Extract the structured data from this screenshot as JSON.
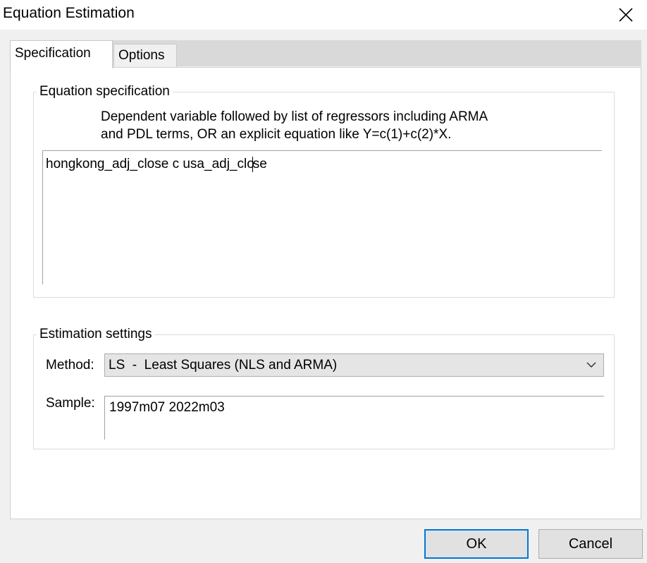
{
  "window": {
    "title": "Equation Estimation",
    "close_icon": "close-icon"
  },
  "tabs": [
    {
      "label": "Specification",
      "active": true
    },
    {
      "label": "Options",
      "active": false
    }
  ],
  "equation_spec": {
    "group_label": "Equation specification",
    "hint_line1": "Dependent variable followed by list of regressors including ARMA",
    "hint_line2": "and PDL terms, OR an explicit equation like Y=c(1)+c(2)*X.",
    "value_before_caret": "hongkong_adj_close c usa_adj_clo",
    "value_after_caret": "se"
  },
  "estimation_settings": {
    "group_label": "Estimation settings",
    "method_label": "Method:",
    "method_value": "LS  -  Least Squares (NLS and ARMA)",
    "sample_label": "Sample:",
    "sample_value": "1997m07 2022m03"
  },
  "buttons": {
    "ok": "OK",
    "cancel": "Cancel"
  }
}
